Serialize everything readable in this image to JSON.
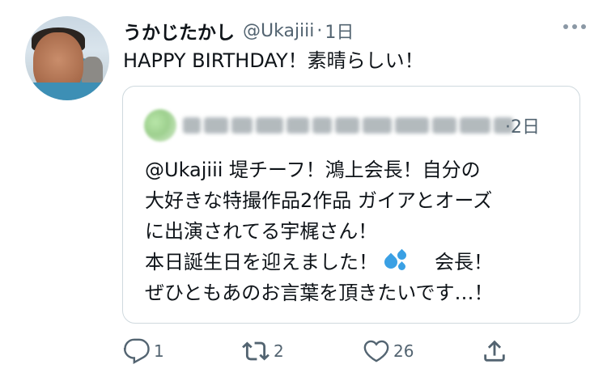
{
  "tweet": {
    "display_name": "うかじたかし",
    "handle": "@Ukajiii",
    "separator": "·",
    "time": "1日",
    "text": "HAPPY BIRTHDAY！素晴らしい！"
  },
  "quoted_tweet": {
    "time": "·2日",
    "lines": [
      "@Ukajiii  堤チーフ！鴻上会長！自分の",
      "大好きな特撮作品2作品 ガイアとオーズ",
      "に出演されてる宇梶さん！",
      "本日誕生日を迎えました！",
      "会長！",
      "ぜひともあのお言葉を頂きたいです…！"
    ]
  },
  "actions": {
    "reply_count": "1",
    "retweet_count": "2",
    "like_count": "26"
  },
  "icons": {
    "more": "more-icon",
    "reply": "reply-icon",
    "retweet": "retweet-icon",
    "like": "like-icon",
    "share": "share-icon",
    "sweat_emoji": "sweat-droplets-icon"
  },
  "colors": {
    "text": "#0f1419",
    "secondary": "#536471",
    "border": "#cfd9de",
    "emoji": "#3aa0e4"
  }
}
